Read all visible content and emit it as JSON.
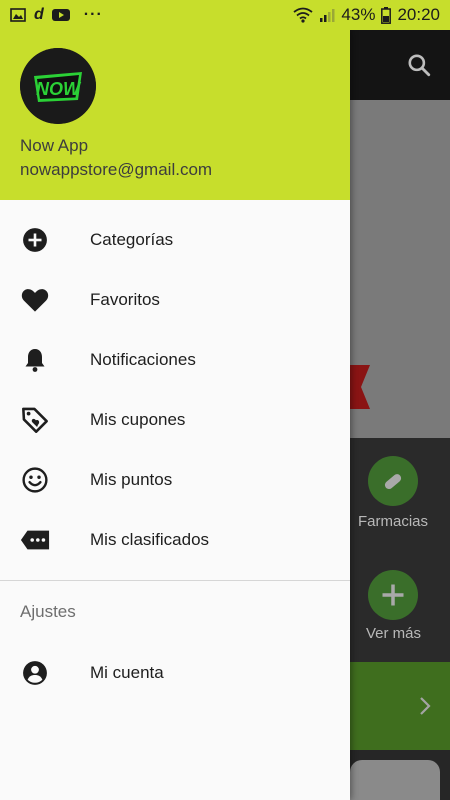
{
  "status_bar": {
    "battery": "43%",
    "time": "20:20",
    "more": "···",
    "app_badge_text": "d"
  },
  "header": {
    "logo_text": "NOW",
    "user_name": "Now App",
    "user_email": "nowappstore@gmail.com"
  },
  "menu": {
    "items": [
      {
        "label": "Categorías",
        "icon": "add-circle-icon"
      },
      {
        "label": "Favoritos",
        "icon": "heart-icon"
      },
      {
        "label": "Notificaciones",
        "icon": "bell-icon"
      },
      {
        "label": "Mis cupones",
        "icon": "tag-heart-icon"
      },
      {
        "label": "Mis puntos",
        "icon": "smiley-icon"
      },
      {
        "label": "Mis clasificados",
        "icon": "label-dots-icon"
      }
    ],
    "section_title": "Ajustes",
    "account_label": "Mi cuenta"
  },
  "background": {
    "category_1": "Farmacias",
    "category_2": "Ver más"
  },
  "colors": {
    "accent": "#c7de2c",
    "drawer_bg": "#fafafa",
    "logo_green": "#2bd136"
  }
}
